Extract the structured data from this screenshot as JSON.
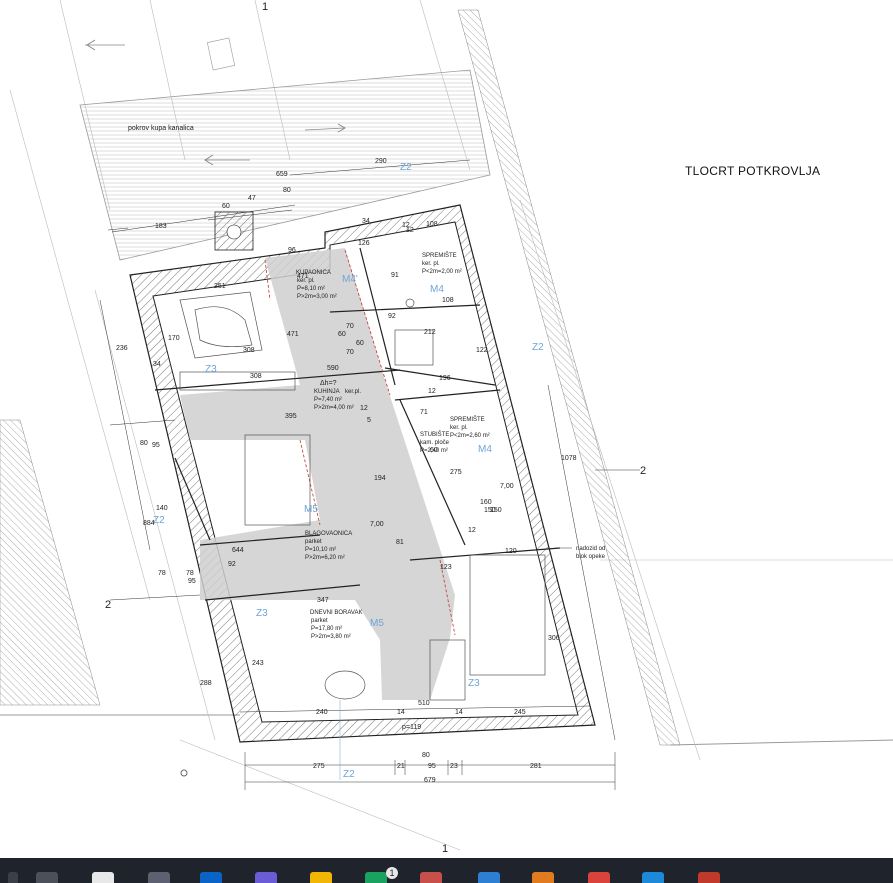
{
  "page_title": "TLOCRT POTKROVLJA",
  "roof_label": "pokrov kupa kanalica",
  "note_wall": [
    "nadozid od",
    "blok opeke"
  ],
  "watermark": "",
  "rooms": [
    {
      "name": "KUPAONICA",
      "finish": "ker. pl.",
      "area": "P=8,10 m²",
      "area2": "P>2m=3,00 m²"
    },
    {
      "name": "SPREMIŠTE",
      "finish": "ker. pl.",
      "area": "P<2m=2,00 m²"
    },
    {
      "name": "KUHINJA",
      "finish": "ker.pl.",
      "area": "P=7,40 m²",
      "area2": "P>2m=4,00 m²"
    },
    {
      "name": "SPREMIŠTE",
      "finish": "ker. pl.",
      "area": "P<2m=2,60 m²"
    },
    {
      "name": "STUBIŠTE",
      "finish": "kam. ploče",
      "area": "P=2,40 m²"
    },
    {
      "name": "BLAGOVAONICA",
      "finish": "parket",
      "area": "P=10,10 m²",
      "area2": "P>2m=6,20 m²"
    },
    {
      "name": "DNEVNI BORAVAK",
      "finish": "parket",
      "area": "P=17,80 m²",
      "area2": "P>2m=3,80 m²"
    }
  ],
  "codes": {
    "z2": "Z2",
    "z3": "Z3",
    "m4": "M4",
    "m4p": "M4'",
    "m5": "M5"
  },
  "section_marks": {
    "one": "1",
    "two": "2"
  },
  "dims": {
    "top": [
      "659",
      "60",
      "47",
      "80",
      "290",
      "183",
      "96",
      "34",
      "108",
      "12",
      "126",
      "251",
      "471",
      "91",
      "92",
      "108",
      "70",
      "60",
      "212",
      "170",
      "308",
      "471",
      "70",
      "590",
      "34",
      "308",
      "196",
      "12",
      "12",
      "122"
    ],
    "mid": [
      "395",
      "71",
      "12",
      "5",
      "194",
      "275",
      "1078",
      "160",
      "150",
      "81",
      "120",
      "123",
      "236",
      "80",
      "95",
      "140",
      "884",
      "644",
      "92",
      "78",
      "95",
      "78",
      "12"
    ],
    "bottom": [
      "347",
      "243",
      "288",
      "306",
      "240",
      "14",
      "510",
      "14",
      "245",
      "p=119",
      "275",
      "21",
      "95",
      "23",
      "281",
      "80",
      "679",
      "150",
      "60",
      "60",
      "7,00",
      "7,00",
      "Δh=?"
    ]
  },
  "taskbar": {
    "badge": "1"
  }
}
